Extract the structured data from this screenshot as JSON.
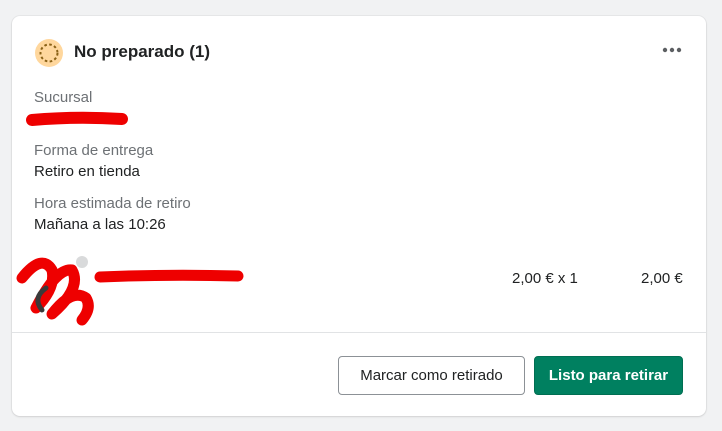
{
  "order": {
    "status_title": "No preparado (1)",
    "status_icon": "incomplete-circle-icon",
    "more_icon": "more-horizontal-icon"
  },
  "fields": {
    "branch_label": "Sucursal",
    "delivery_label": "Forma de entrega",
    "delivery_value": "Retiro en tienda",
    "pickup_time_label": "Hora estimada de retiro",
    "pickup_time_value": "Mañana a las 10:26"
  },
  "line_item": {
    "unit_price_qty": "2,00 € x 1",
    "total": "2,00 €"
  },
  "actions": {
    "mark_picked_up": "Marcar como retirado",
    "ready_for_pickup": "Listo para retirar"
  },
  "colors": {
    "primary": "#008060",
    "status_yellow": "#ffd79d",
    "redaction": "#ee0000"
  }
}
